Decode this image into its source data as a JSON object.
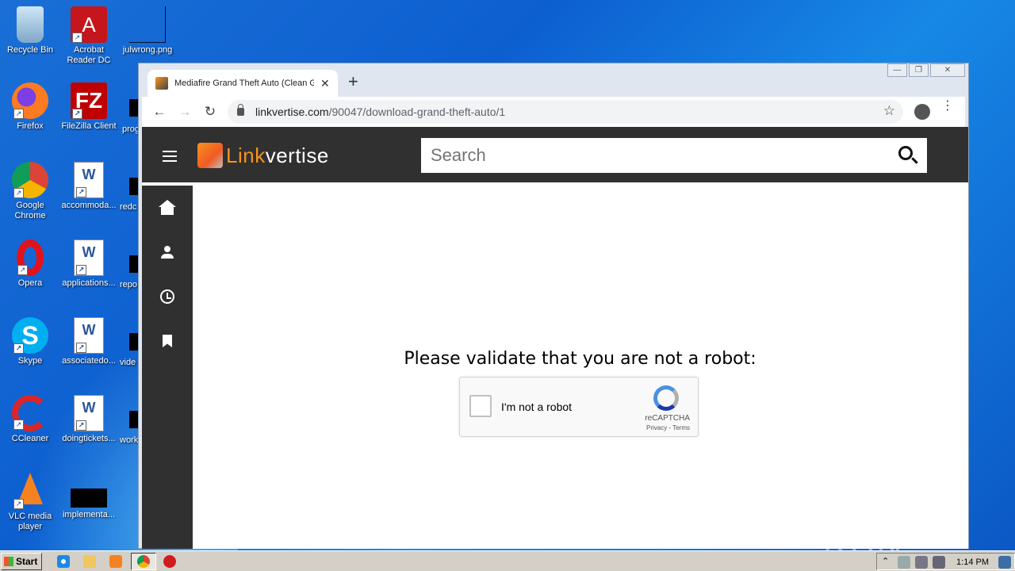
{
  "desktop": {
    "icons": [
      {
        "label": "Recycle Bin"
      },
      {
        "label": "Acrobat Reader DC"
      },
      {
        "label": "julwrong.png"
      },
      {
        "label": "Firefox"
      },
      {
        "label": "FileZilla Client"
      },
      {
        "label": "Google Chrome"
      },
      {
        "label": "accommoda..."
      },
      {
        "label": "Opera"
      },
      {
        "label": "applications..."
      },
      {
        "label": "Skype"
      },
      {
        "label": "associatedo..."
      },
      {
        "label": "CCleaner"
      },
      {
        "label": "doingtickets..."
      },
      {
        "label": "VLC media player"
      },
      {
        "label": "implementa..."
      }
    ],
    "cut_labels": [
      "prog",
      "redc",
      "repo",
      "vide",
      "work"
    ]
  },
  "browser": {
    "tab_title": "Mediafire Grand Theft Auto (Clean G",
    "tab_close": "✕",
    "new_tab": "+",
    "url_domain": "linkvertise.com",
    "url_path": "/90047/download-grand-theft-auto/1",
    "back": "←",
    "forward": "→",
    "reload": "↻",
    "bookmark_star": "☆",
    "menu": "⋮",
    "window_controls": {
      "minimize": "—",
      "restore": "❐",
      "close": "✕"
    }
  },
  "page": {
    "logo_link": "Link",
    "logo_vertise": "vertise",
    "search_placeholder": "Search",
    "prompt": "Please validate that you are not a robot:",
    "recaptcha": {
      "label": "I'm not a robot",
      "brand": "reCAPTCHA",
      "links": "Privacy - Terms"
    },
    "sidebar": [
      "home-icon",
      "user-icon",
      "history-icon",
      "bookmark-icon"
    ]
  },
  "watermark": "ANY ▷ RUN",
  "taskbar": {
    "start": "Start",
    "clock": "1:14 PM"
  }
}
